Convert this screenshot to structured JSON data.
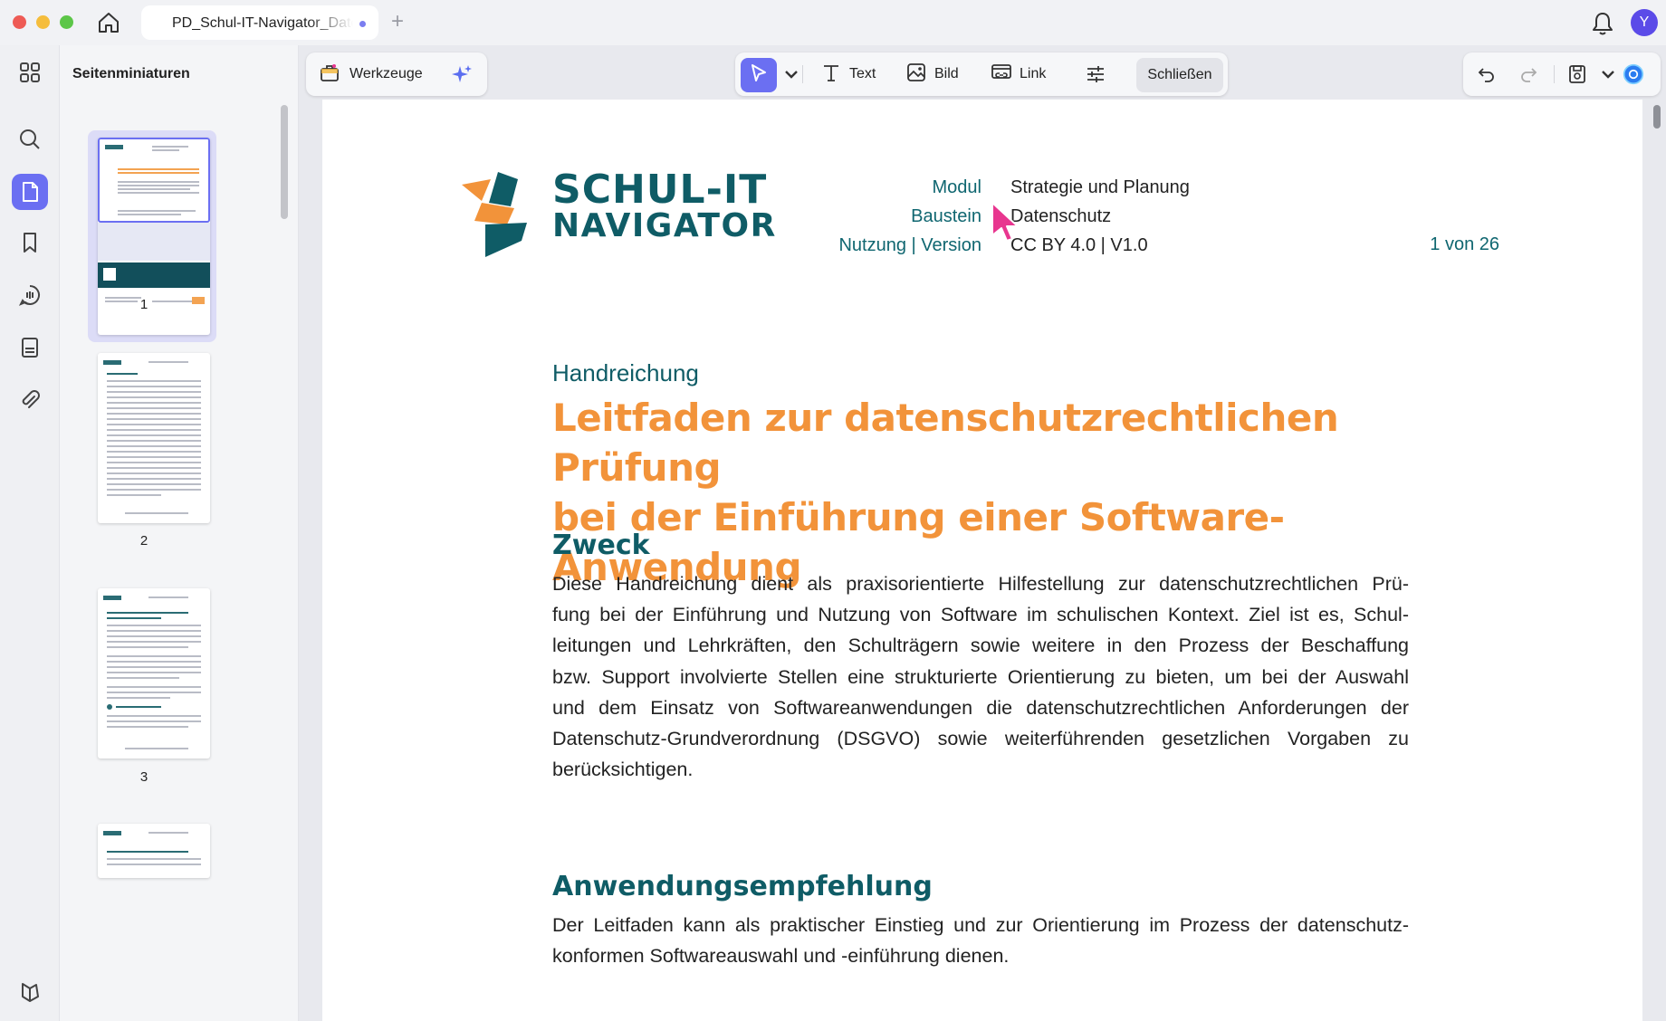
{
  "titlebar": {
    "tab_title": "PD_Schul-IT-Navigator_Datenschutz",
    "new_tab": "+",
    "avatar_initial": "Y"
  },
  "rail": {
    "items": [
      "grid-icon",
      "search-icon",
      "page-icon",
      "bookmark-icon",
      "comment-icon",
      "form-icon",
      "attachment-icon",
      "layers-icon"
    ]
  },
  "thumbnails": {
    "title": "Seitenminiaturen",
    "pages": [
      "1",
      "2",
      "3"
    ]
  },
  "toolbar": {
    "tools_label": "Werkzeuge",
    "text_label": "Text",
    "image_label": "Bild",
    "link_label": "Link",
    "close_label": "Schließen"
  },
  "document": {
    "logo_line1": "SCHUL-IT",
    "logo_line2": "NAVIGATOR",
    "meta": {
      "modul_label": "Modul",
      "modul_value": "Strategie und Planung",
      "baustein_label": "Baustein",
      "baustein_value": "Datenschutz",
      "usage_label": "Nutzung | Version",
      "usage_value": "CC BY 4.0 | V1.0"
    },
    "page_count": "1 von 26",
    "subtitle": "Handreichung",
    "title_line1": "Leitfaden zur datenschutzrechtlichen Prüfung",
    "title_line2": "bei der Einführung einer Software-Anwendung",
    "section1_heading": "Zweck",
    "section1_lines": [
      "Diese Handreichung dient als praxisorientierte Hilfestellung zur datenschutzrechtlichen Prü-",
      "fung bei der Einführung und Nutzung von Software im schulischen Kontext. Ziel ist es, Schul-",
      "leitungen und Lehrkräften, den Schulträgern sowie weitere in den Prozess der Beschaffung",
      "bzw. Support involvierte Stellen eine strukturierte Orientierung zu bieten, um bei der Auswahl",
      "und dem Einsatz von Softwareanwendungen die datenschutzrechtlichen Anforderungen der",
      "Datenschutz-Grundverordnung (DSGVO) sowie weiterführenden gesetzlichen Vorgaben zu",
      "berücksichtigen."
    ],
    "section2_heading": "Anwendungsempfehlung",
    "section2_lines": [
      "Der Leitfaden kann als praktischer Einstieg und zur Orientierung im Prozess der datenschutz-",
      "konformen Softwareauswahl und -einführung dienen."
    ]
  },
  "colors": {
    "accent": "#6b6ff2",
    "brand_teal": "#0f5c66",
    "brand_orange": "#f2933a",
    "cursor_pink": "#e8368f"
  }
}
